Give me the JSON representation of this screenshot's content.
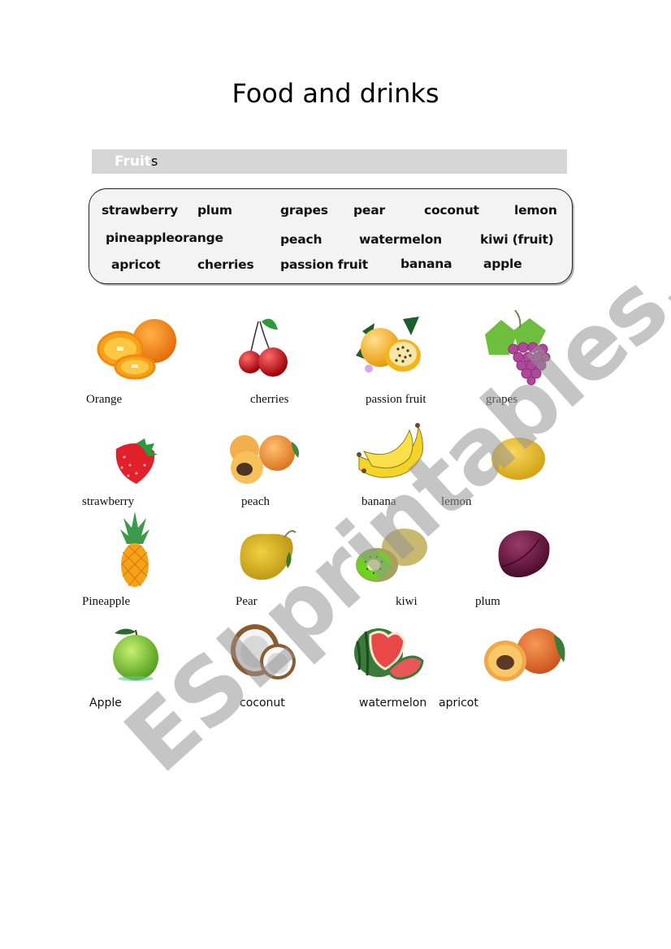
{
  "page": {
    "title": "Food and drinks",
    "section": {
      "label_white": "Fruit",
      "label_dark": "s"
    },
    "word_bank": [
      "strawberry",
      "plum",
      "grapes",
      "pear",
      "coconut",
      "lemon",
      "pineappleorange",
      "peach",
      "watermelon",
      "kiwi (fruit)",
      "apricot",
      "cherries",
      "passion fruit",
      "banana",
      "apple"
    ],
    "fruits": [
      {
        "label": "Orange",
        "icon": "orange-icon"
      },
      {
        "label": "cherries",
        "icon": "cherries-icon"
      },
      {
        "label": "passion fruit",
        "icon": "passion-fruit-icon"
      },
      {
        "label": "grapes",
        "icon": "grapes-icon"
      },
      {
        "label": "strawberry",
        "icon": "strawberry-icon"
      },
      {
        "label": "peach",
        "icon": "peach-icon"
      },
      {
        "label": "banana",
        "icon": "banana-icon"
      },
      {
        "label": "lemon",
        "icon": "lemon-icon"
      },
      {
        "label": "Pineapple",
        "icon": "pineapple-icon"
      },
      {
        "label": "Pear",
        "icon": "pear-icon"
      },
      {
        "label": "kiwi",
        "icon": "kiwi-icon"
      },
      {
        "label": "plum",
        "icon": "plum-icon"
      },
      {
        "label": "Apple",
        "icon": "apple-icon"
      },
      {
        "label": "coconut",
        "icon": "coconut-icon"
      },
      {
        "label": "watermelon",
        "icon": "watermelon-icon"
      },
      {
        "label": "apricot",
        "icon": "apricot-icon"
      }
    ],
    "watermark": "ESLprintables.com"
  }
}
